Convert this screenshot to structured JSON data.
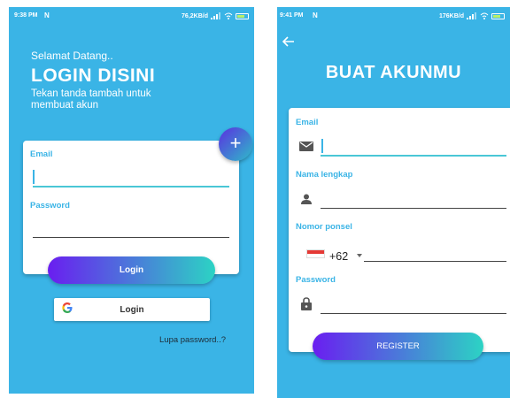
{
  "login_screen": {
    "status_bar": {
      "time": "9:38 PM",
      "network_speed": "76,2KB/d"
    },
    "greeting": "Selamat Datang..",
    "title": "LOGIN DISINI",
    "subtitle": "Tekan tanda tambah untuk membuat akun",
    "add_button_icon": "plus-icon",
    "email_label": "Email",
    "password_label": "Password",
    "login_button": "Login",
    "google_button": "Login",
    "forgot_password": "Lupa password..?"
  },
  "register_screen": {
    "status_bar": {
      "time": "9:41 PM",
      "network_speed": "176KB/d"
    },
    "back_icon": "arrow-left-icon",
    "title": "BUAT AKUNMU",
    "email_label": "Email",
    "name_label": "Nama lengkap",
    "phone_label": "Nomor ponsel",
    "country_code": "+62",
    "password_label": "Password",
    "register_button": "REGISTER"
  },
  "colors": {
    "background": "#3ab4e6",
    "accent": "#3ab4e6",
    "gradient_start": "#6a1ef0",
    "gradient_end": "#2cd3c4",
    "card": "#ffffff"
  }
}
